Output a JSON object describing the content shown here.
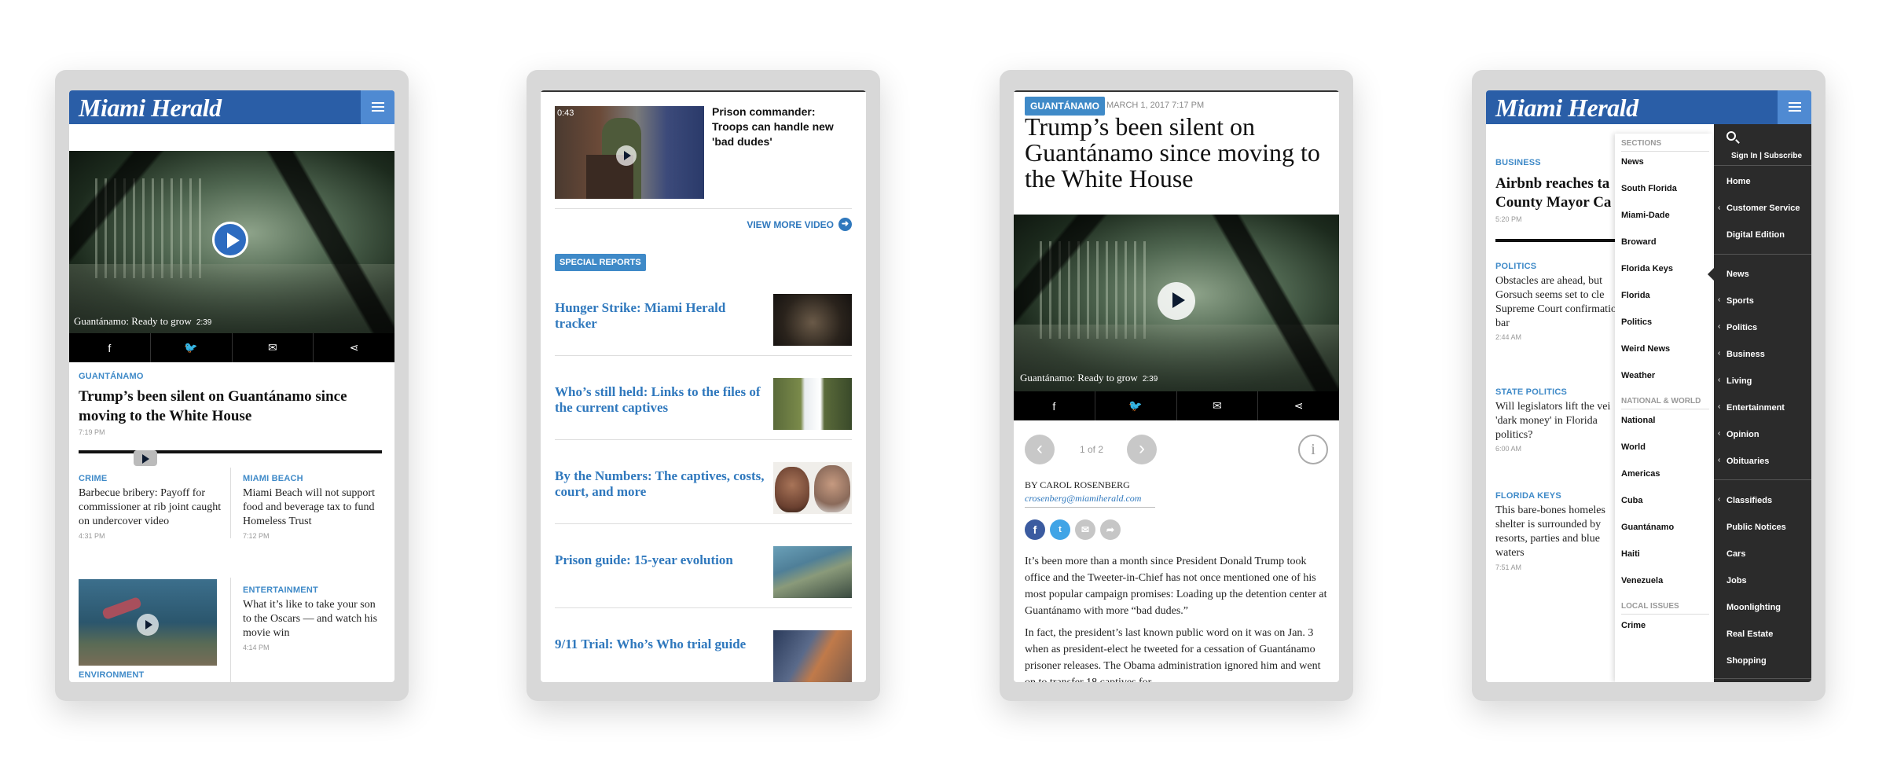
{
  "brand": {
    "name": "Miami Herald",
    "blue": "#2a5ea7",
    "accent": "#3f8ac8"
  },
  "screen1": {
    "video": {
      "caption": "Guantánamo: Ready to grow",
      "duration": "2:39"
    },
    "share_icons": [
      "facebook-icon",
      "twitter-icon",
      "email-icon",
      "share-icon"
    ],
    "lead": {
      "kicker": "GUANTÁNAMO",
      "headline": "Trump’s been silent on Guantánamo since moving to the White House",
      "time": "7:19 PM"
    },
    "stories": [
      {
        "kicker": "CRIME",
        "text": "Barbecue bribery: Payoff for commissioner at rib joint caught on undercover video",
        "time": "4:31 PM"
      },
      {
        "kicker": "MIAMI BEACH",
        "text": "Miami Beach will not support food and beverage tax to fund Homeless Trust",
        "time": "7:12 PM"
      },
      {
        "kicker": "ENTERTAINMENT",
        "text": "What it’s like to take your son to the Oscars — and watch his movie win",
        "time": "4:14 PM"
      },
      {
        "kicker": "ENVIRONMENT"
      }
    ]
  },
  "screen2": {
    "video": {
      "duration": "0:43",
      "title": "Prison commander: Troops can handle new 'bad dudes'"
    },
    "view_more": "VIEW MORE VIDEO",
    "badge": "SPECIAL REPORTS",
    "reports": [
      "Hunger Strike: Miami Herald tracker",
      "Who’s still held: Links to the files of the current captives",
      "By the Numbers: The captives, costs, court, and more",
      "Prison guide: 15-year evolution",
      "9/11 Trial: Who’s Who trial guide"
    ]
  },
  "screen3": {
    "badge": "GUANTÁNAMO",
    "date": "MARCH 1, 2017 7:17 PM",
    "headline": "Trump’s been silent on Guantánamo since moving to the White House",
    "video": {
      "caption": "Guantánamo: Ready to grow",
      "duration": "2:39"
    },
    "pager": "1 of 2",
    "byline": "BY CAROL ROSENBERG",
    "email": "crosenberg@miamiherald.com",
    "paragraphs": [
      "It’s been more than a month since President Donald Trump took office and the Tweeter-in-Chief has not once mentioned one of his most popular campaign promises: Loading up the detention center at Guantánamo with more “bad dudes.”",
      "In fact, the president’s last known public word on it was on Jan. 3 when as president-elect he tweeted for a cessation of Guantánamo prisoner releases. The Obama administration ignored him and went on to transfer 18 captives for"
    ]
  },
  "screen4": {
    "stories": [
      {
        "kicker": "BUSINESS",
        "headline": "Airbnb reaches ta County Mayor Ca",
        "time": "5:20 PM"
      },
      {
        "kicker": "POLITICS",
        "text": "Obstacles are ahead, but Gorsuch seems set to cle Supreme Court confirmation bar",
        "time": "2:44 AM"
      },
      {
        "kicker": "STATE POLITICS",
        "text": "Will legislators lift the vei 'dark money' in Florida politics?",
        "time": "6:00 AM"
      },
      {
        "kicker": "FLORIDA KEYS",
        "text": "This bare-bones homeles shelter is surrounded by resorts, parties and blue waters",
        "time": "7:51 AM"
      }
    ],
    "sections_heading": "SECTIONS",
    "sections": [
      "News",
      "South Florida",
      "Miami-Dade",
      "Broward",
      "Florida Keys",
      "Florida",
      "Politics",
      "Weird News",
      "Weather"
    ],
    "national_heading": "NATIONAL & WORLD",
    "national": [
      "National",
      "World",
      "Americas",
      "Cuba",
      "Guantánamo",
      "Haiti",
      "Venezuela"
    ],
    "local_heading": "LOCAL ISSUES",
    "local": [
      "Crime"
    ],
    "signin": "Sign In | Subscribe",
    "nav_top": [
      "Home",
      "Customer Service",
      "Digital Edition"
    ],
    "nav_main": [
      "News",
      "Sports",
      "Politics",
      "Business",
      "Living",
      "Entertainment",
      "Opinion",
      "Obituaries"
    ],
    "nav_bottom": [
      "Classifieds",
      "Public Notices",
      "Cars",
      "Jobs",
      "Moonlighting",
      "Real Estate",
      "Shopping"
    ]
  }
}
